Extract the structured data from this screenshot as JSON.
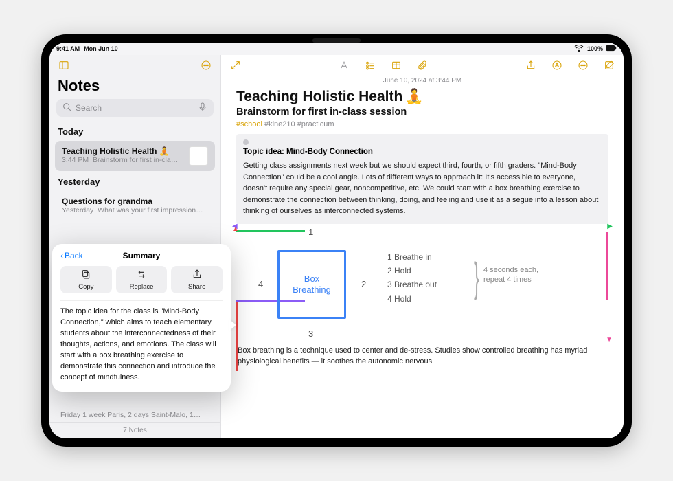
{
  "status": {
    "time": "9:41 AM",
    "date": "Mon Jun 10",
    "battery": "100%"
  },
  "sidebar": {
    "title": "Notes",
    "search_placeholder": "Search",
    "sections": {
      "today": "Today",
      "yesterday": "Yesterday"
    },
    "today_note": {
      "title": "Teaching Holistic Health",
      "emoji": "🧘",
      "time": "3:44 PM",
      "preview": "Brainstorm for first in-cla…"
    },
    "yesterday_note": {
      "title": "Questions for grandma",
      "time": "Yesterday",
      "preview": "What was your first impression…"
    },
    "last_row": "Friday  1 week Paris, 2 days Saint-Malo, 1…",
    "footer": "7 Notes"
  },
  "popover": {
    "back": "Back",
    "title": "Summary",
    "actions": {
      "copy": "Copy",
      "replace": "Replace",
      "share": "Share"
    },
    "body": "The topic idea for the class is \"Mind-Body Connection,\" which aims to teach elementary students about the interconnectedness of their thoughts, actions, and emotions. The class will start with a box breathing exercise to demonstrate this connection and introduce the concept of mindfulness."
  },
  "note": {
    "date_line": "June 10, 2024 at 3:44 PM",
    "title": "Teaching Holistic Health",
    "emoji": "🧘",
    "subtitle": "Brainstorm for first in-class session",
    "tags": {
      "highlight": "#school",
      "rest": "#kine210 #practicum"
    },
    "topic_label": "Topic idea: Mind-Body Connection",
    "para1": "Getting class assignments next week but we should expect third, fourth, or fifth graders. \"Mind-Body Connection\" could be a cool angle. Lots of different ways to approach it: It's accessible to everyone, doesn't require any special gear, noncompetitive, etc. We could start with a box breathing exercise to demonstrate the connection between thinking, doing, and feeling and use it as a segue into a lesson about thinking of ourselves as interconnected systems.",
    "para2": "Box breathing is a technique used to center and de-stress. Studies show controlled breathing has myriad physiological benefits — it soothes the autonomic nervous",
    "sketch": {
      "box_label": "Box\nBreathing",
      "n1": "1",
      "n2": "2",
      "n3": "3",
      "n4": "4",
      "steps": [
        "1  Breathe in",
        "2  Hold",
        "3  Breathe out",
        "4  Hold"
      ],
      "annot": "4 seconds each,\nrepeat 4 times"
    }
  }
}
